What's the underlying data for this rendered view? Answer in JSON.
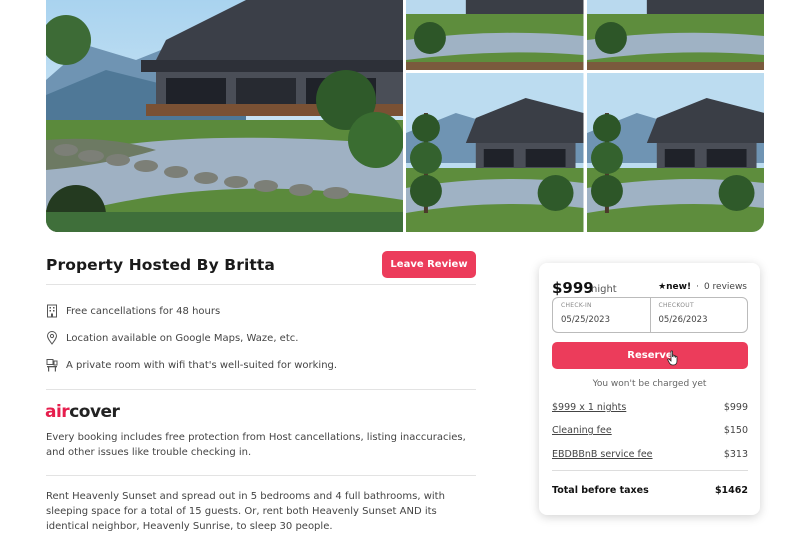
{
  "gallery": {
    "main_alt": "Japanese house with garden",
    "thumbnails": [
      "Japanese house thumbnail 1",
      "Japanese house thumbnail 2",
      "Japanese house thumbnail 3",
      "Japanese house thumbnail 4"
    ]
  },
  "listing": {
    "title": "Property Hosted By Britta",
    "leave_review_label": "Leave Review",
    "features": [
      {
        "icon": "building-icon",
        "text": "Free cancellations for 48 hours"
      },
      {
        "icon": "location-pin-icon",
        "text": "Location available on Google Maps, Waze, etc."
      },
      {
        "icon": "workspace-icon",
        "text": "A private room with wifi that's well-suited for working."
      }
    ],
    "aircover": {
      "logo_air": "air",
      "logo_cover": "cover",
      "description": "Every booking includes free protection from Host cancellations, listing inaccuracies, and other issues like trouble checking in."
    },
    "description": "Rent Heavenly Sunset and spread out in 5 bedrooms and 4 full bathrooms, with sleeping space for a total of 15 guests. Or, rent both Heavenly Sunset AND its identical neighbor, Heavenly Sunrise, to sleep 30 people."
  },
  "booking": {
    "price": "$999",
    "price_unit": "night",
    "rating_badge": "★new!",
    "rating_separator": "·",
    "reviews": "0 reviews",
    "checkin_label": "CHECK-IN",
    "checkin_value": "05/25/2023",
    "checkout_label": "CHECKOUT",
    "checkout_value": "05/26/2023",
    "reserve_label": "Reserve",
    "no_charge_note": "You won't be charged yet",
    "fees": [
      {
        "label": "$999 x 1 nights",
        "amount": "$999"
      },
      {
        "label": "Cleaning fee",
        "amount": "$150"
      },
      {
        "label": "EBDBBnB service fee",
        "amount": "$313"
      }
    ],
    "total_label": "Total before taxes",
    "total_amount": "$1462"
  },
  "colors": {
    "accent": "#ec3c5b",
    "aircover_red": "#e61e4d"
  }
}
